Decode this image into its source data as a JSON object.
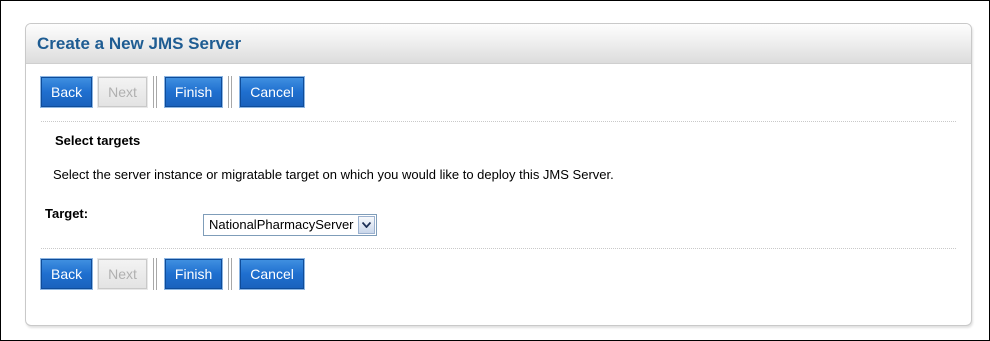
{
  "panel": {
    "title": "Create a New JMS Server"
  },
  "buttons": {
    "back": "Back",
    "next": "Next",
    "finish": "Finish",
    "cancel": "Cancel"
  },
  "section": {
    "heading": "Select targets",
    "description": "Select the server instance or migratable target on which you would like to deploy this JMS Server."
  },
  "target": {
    "label": "Target:",
    "selected": "NationalPharmacyServer"
  },
  "colors": {
    "title_text": "#1e5c92",
    "button_bg": "#1f6fcf",
    "button_disabled_bg": "#e3e3e3"
  },
  "icons": {
    "dropdown": "chevron-down-icon"
  }
}
